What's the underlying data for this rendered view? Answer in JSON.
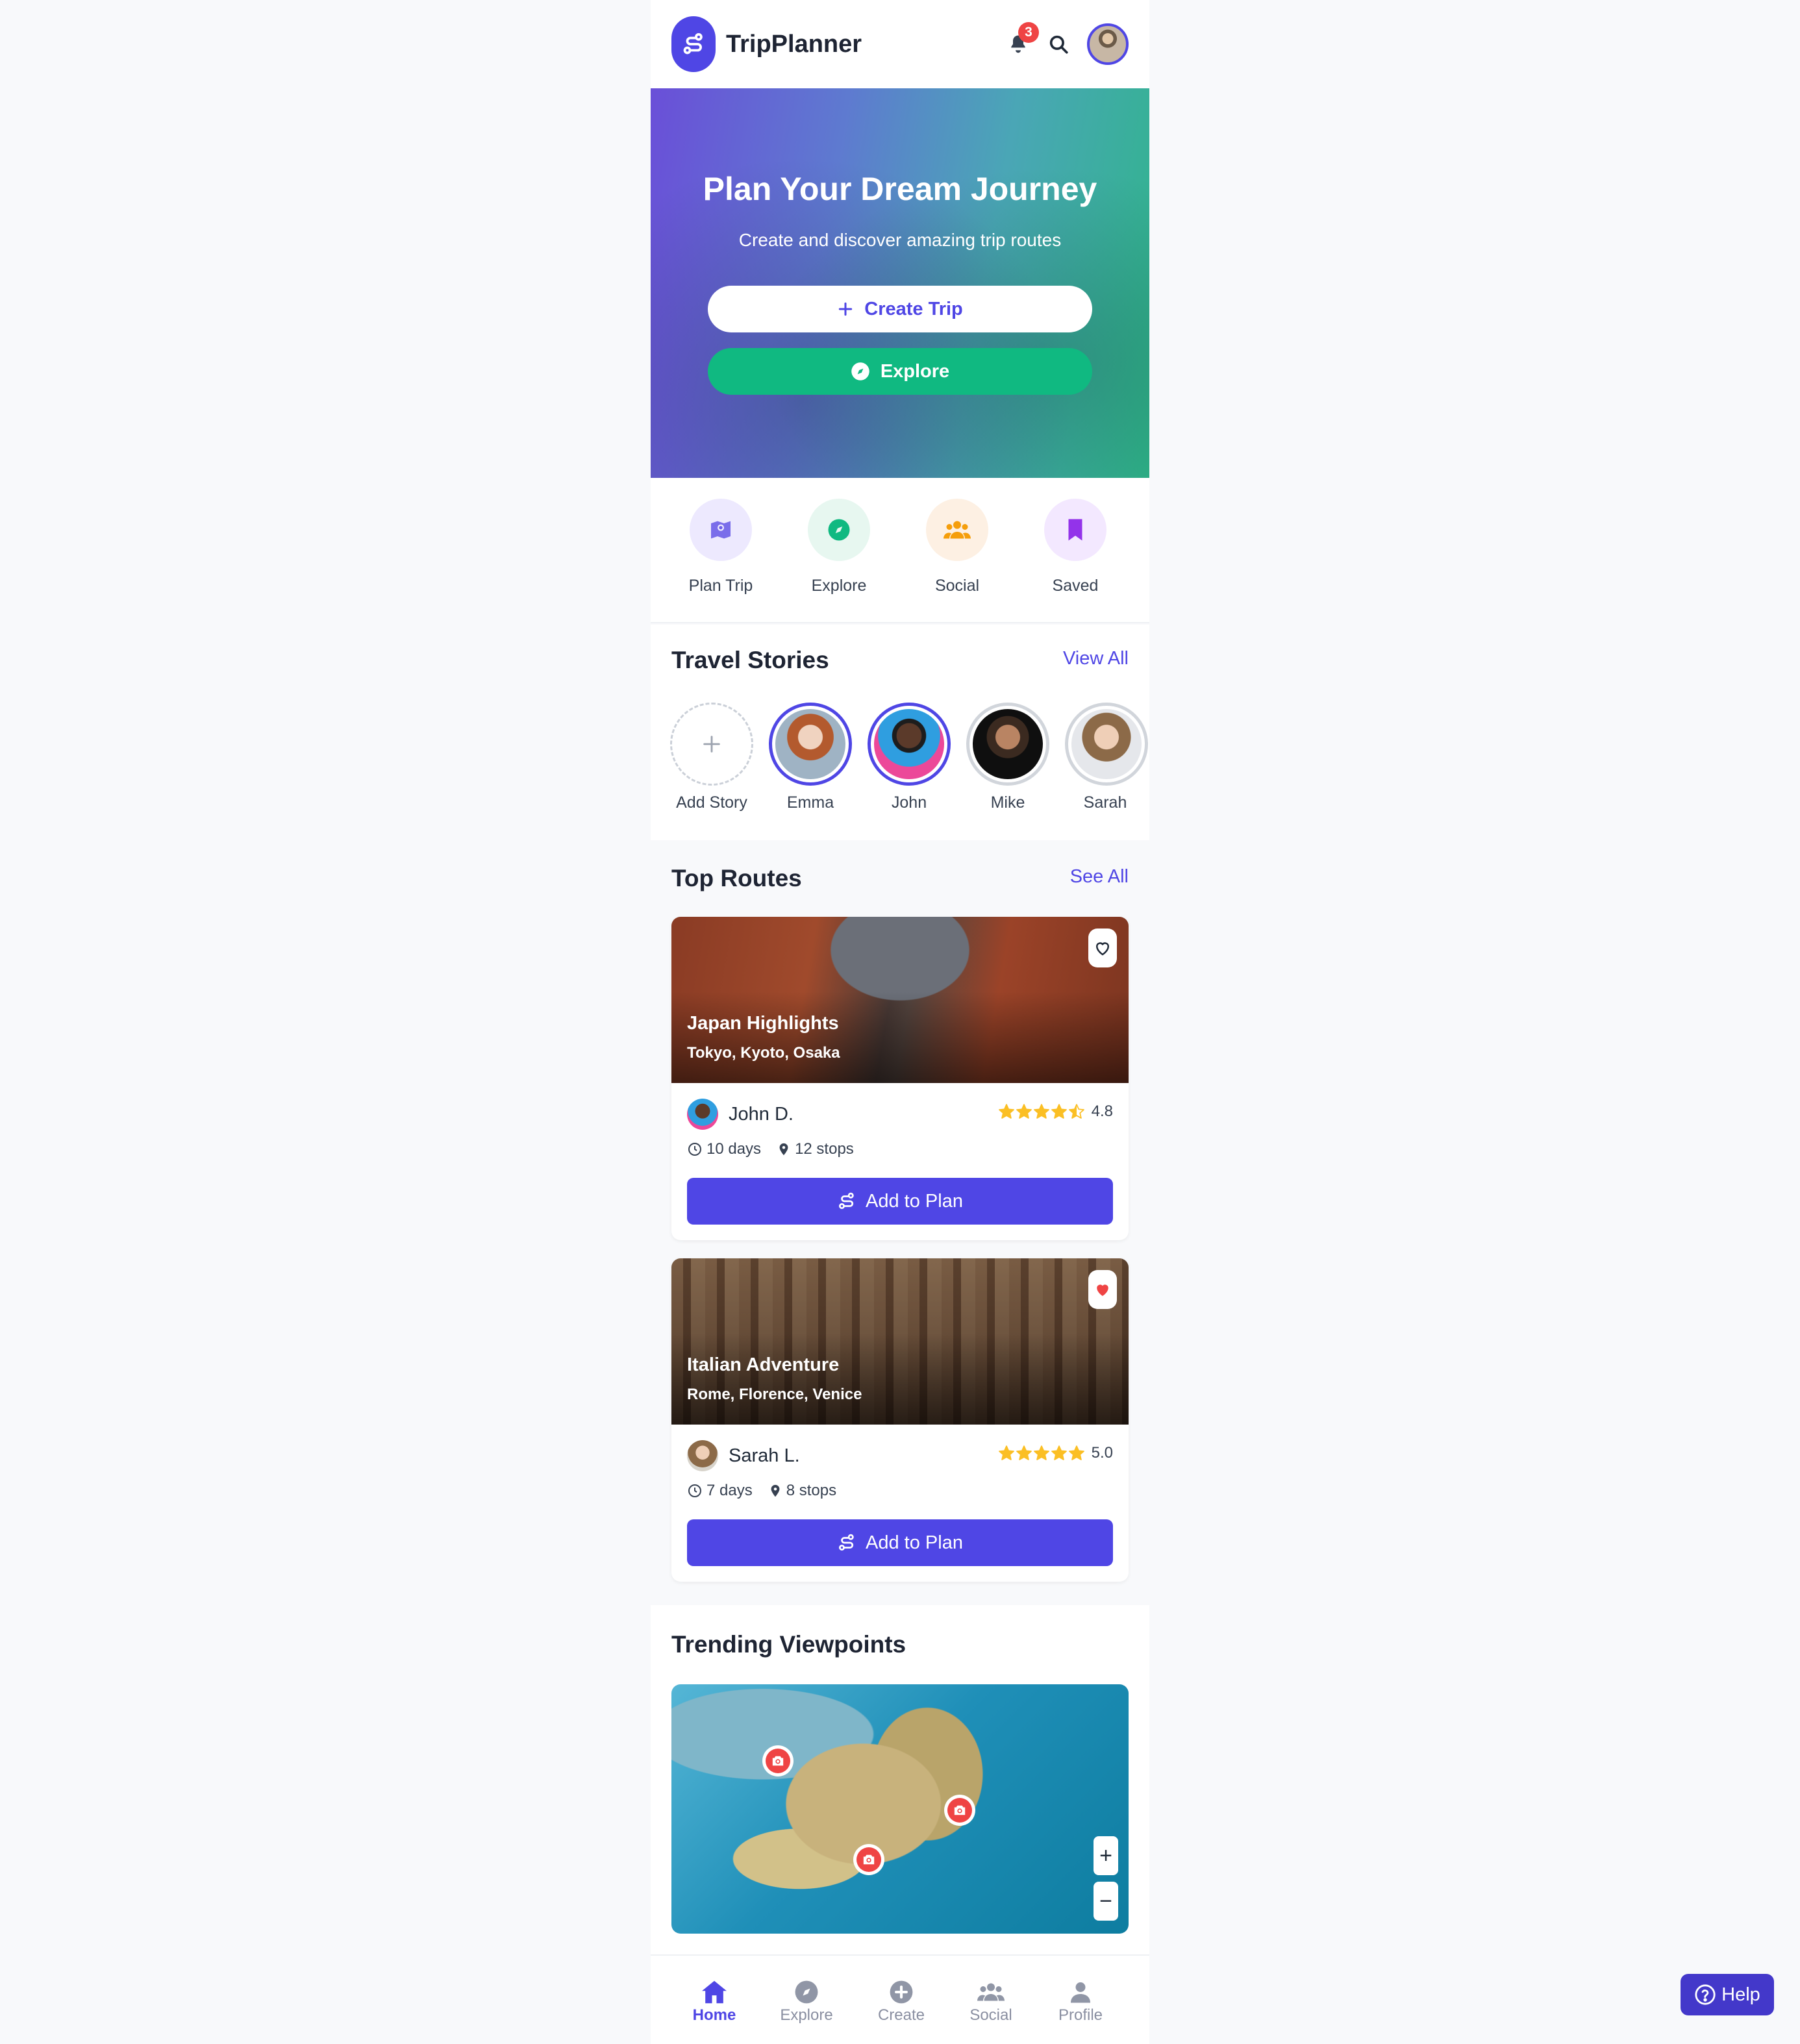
{
  "header": {
    "app_title": "TripPlanner",
    "notification_count": "3"
  },
  "hero": {
    "title": "Plan Your Dream Journey",
    "subtitle": "Create and discover amazing trip routes",
    "create_label": "Create Trip",
    "explore_label": "Explore"
  },
  "quick_actions": [
    {
      "label": "Plan Trip",
      "icon": "map-icon",
      "color": "#6d5fe8",
      "bg": "#ede9fe"
    },
    {
      "label": "Explore",
      "icon": "compass-icon",
      "color": "#10b981",
      "bg": "#e7f7f0"
    },
    {
      "label": "Social",
      "icon": "users-icon",
      "color": "#f59e0b",
      "bg": "#fdf0e3"
    },
    {
      "label": "Saved",
      "icon": "bookmark-icon",
      "color": "#9333ea",
      "bg": "#f3e8ff"
    }
  ],
  "stories": {
    "title": "Travel Stories",
    "link": "View All",
    "items": [
      {
        "name": "Add Story"
      },
      {
        "name": "Emma"
      },
      {
        "name": "John"
      },
      {
        "name": "Mike"
      },
      {
        "name": "Sarah"
      }
    ]
  },
  "routes": {
    "title": "Top Routes",
    "link": "See All",
    "items": [
      {
        "title": "Japan Highlights",
        "places": "Tokyo, Kyoto, Osaka",
        "author": "John D.",
        "rating": "4.8",
        "rating_stars": 4.5,
        "duration": "10 days",
        "stops": "12 stops",
        "favorited": false,
        "button": "Add to Plan"
      },
      {
        "title": "Italian Adventure",
        "places": "Rome, Florence, Venice",
        "author": "Sarah L.",
        "rating": "5.0",
        "rating_stars": 5,
        "duration": "7 days",
        "stops": "8 stops",
        "favorited": true,
        "button": "Add to Plan"
      }
    ]
  },
  "viewpoints": {
    "title": "Trending Viewpoints",
    "zoom_in": "+",
    "zoom_out": "−"
  },
  "bottom_nav": [
    {
      "label": "Home",
      "icon": "home-icon",
      "active": true
    },
    {
      "label": "Explore",
      "icon": "compass-icon",
      "active": false
    },
    {
      "label": "Create",
      "icon": "plus-circle-icon",
      "active": false
    },
    {
      "label": "Social",
      "icon": "users-icon",
      "active": false
    },
    {
      "label": "Profile",
      "icon": "user-icon",
      "active": false
    }
  ],
  "help": {
    "label": "Help"
  },
  "colors": {
    "primary": "#4f46e5",
    "accent_green": "#10b981",
    "star": "#fbbf24",
    "danger": "#ef4444"
  }
}
